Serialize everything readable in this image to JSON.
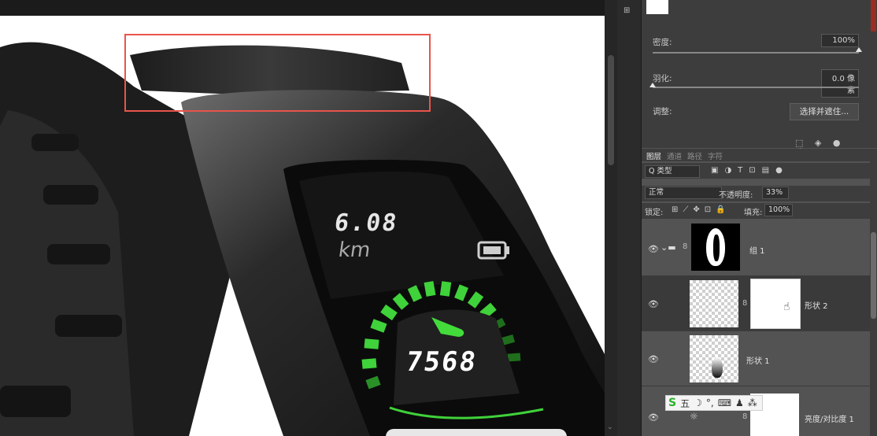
{
  "canvas": {
    "screen_distance": "6.08",
    "screen_unit": "km",
    "screen_steps": "7568"
  },
  "properties": {
    "density_label": "密度:",
    "density_value": "100%",
    "feather_label": "羽化:",
    "feather_value": "0.0 像素",
    "adjust_label": "调整:",
    "select_mask_button": "选择并遮住..."
  },
  "layers_panel": {
    "tabs": [
      "图层",
      "通道",
      "路径",
      "字符"
    ],
    "filter_kind": "Q 类型",
    "blend_mode": "正常",
    "opacity_label": "不透明度:",
    "opacity_value": "33%",
    "lock_label": "锁定:",
    "fill_label": "填充:",
    "fill_value": "100%",
    "layers": [
      {
        "name": "组 1"
      },
      {
        "name": "形状 2"
      },
      {
        "name": "形状 1"
      },
      {
        "name": "亮度/对比度 1"
      }
    ]
  },
  "ime_bar": {
    "logo": "S",
    "mode": "五"
  },
  "colors": {
    "accent_red": "#e8544b",
    "screen_green": "#3fd23a",
    "panel_dark": "#3d3d3d",
    "panel_mid": "#535353"
  }
}
